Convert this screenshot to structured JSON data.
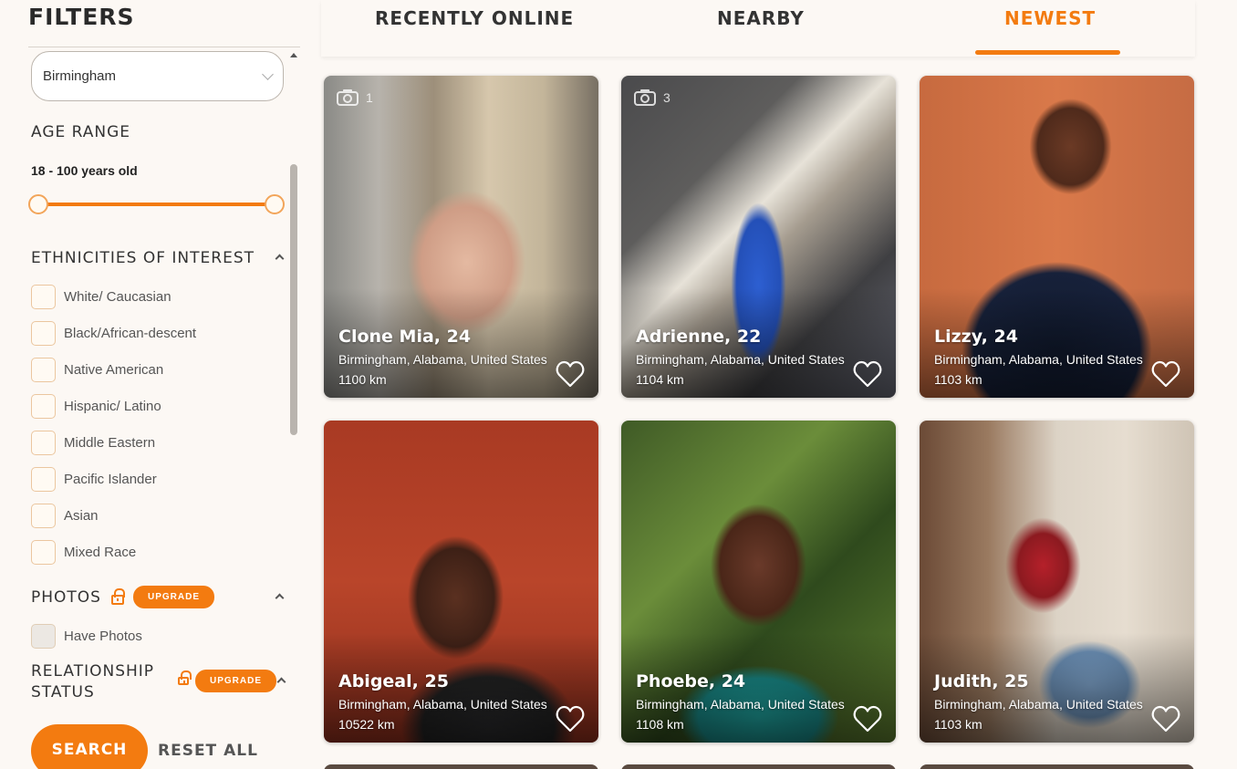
{
  "sidebar": {
    "title": "FILTERS",
    "city": {
      "value": "Birmingham"
    },
    "age_range": {
      "heading": "AGE RANGE",
      "value": "18 - 100 years old",
      "min": 18,
      "max": 100
    },
    "ethnicities": {
      "heading": "ETHNICITIES OF INTEREST",
      "items": [
        {
          "label": "White/ Caucasian",
          "checked": false
        },
        {
          "label": "Black/African-descent",
          "checked": false
        },
        {
          "label": "Native American",
          "checked": false
        },
        {
          "label": "Hispanic/ Latino",
          "checked": false
        },
        {
          "label": "Middle Eastern",
          "checked": false
        },
        {
          "label": "Pacific Islander",
          "checked": false
        },
        {
          "label": "Asian",
          "checked": false
        },
        {
          "label": "Mixed Race",
          "checked": false
        }
      ]
    },
    "photos": {
      "heading": "PHOTOS",
      "upgrade_label": "UPGRADE",
      "option_label": "Have Photos"
    },
    "relationship": {
      "heading_line1": "RELATIONSHIP",
      "heading_line2": "STATUS",
      "upgrade_label": "UPGRADE"
    },
    "search_label": "SEARCH",
    "reset_label": "RESET ALL"
  },
  "tabs": [
    {
      "label": "RECENTLY ONLINE",
      "active": false
    },
    {
      "label": "NEARBY",
      "active": false
    },
    {
      "label": "NEWEST",
      "active": true
    }
  ],
  "cards": [
    {
      "name": "Clone Mia, 24",
      "location": "Birmingham, Alabama, United States",
      "distance": "1100 km",
      "photo_count": "1"
    },
    {
      "name": "Adrienne, 22",
      "location": "Birmingham, Alabama, United States",
      "distance": "1104 km",
      "photo_count": "3"
    },
    {
      "name": "Lizzy, 24",
      "location": "Birmingham, Alabama, United States",
      "distance": "1103 km",
      "photo_count": ""
    },
    {
      "name": "Abigeal, 25",
      "location": "Birmingham, Alabama, United States",
      "distance": "10522 km",
      "photo_count": ""
    },
    {
      "name": "Phoebe, 24",
      "location": "Birmingham, Alabama, United States",
      "distance": "1108 km",
      "photo_count": ""
    },
    {
      "name": "Judith, 25",
      "location": "Birmingham, Alabama, United States",
      "distance": "1103 km",
      "photo_count": ""
    }
  ],
  "colors": {
    "accent": "#f37b10",
    "background": "#fcf8f4"
  }
}
